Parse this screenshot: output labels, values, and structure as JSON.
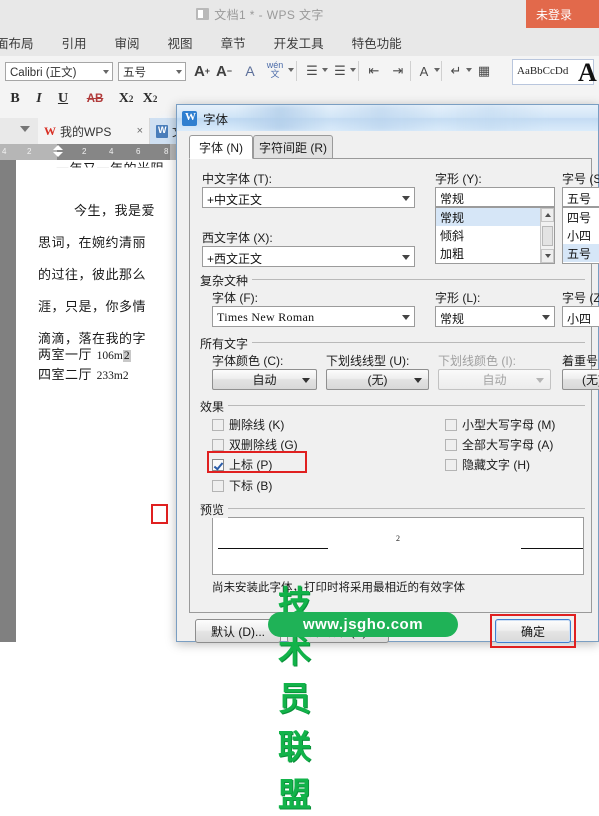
{
  "app": {
    "title": "文档1 * - WPS 文字",
    "login_button": "未登录"
  },
  "ribbon_tabs": [
    "面布局",
    "引用",
    "审阅",
    "视图",
    "章节",
    "开发工具",
    "特色功能"
  ],
  "font_toolbar": {
    "font_name": "Calibri (正文)",
    "font_size": "五号",
    "grow_font": "A",
    "shrink_font": "A",
    "clear_format": "A",
    "pinyin_top": "wén",
    "pinyin_bottom": "文",
    "bold": "B",
    "italic": "I",
    "underline": "U",
    "strikethrough": "AB",
    "superscript": "X",
    "superscript_sup": "2",
    "subscript": "X",
    "subscript_sub": "2",
    "style_preview": "AaBbCcDd",
    "style_big": "A"
  },
  "doc_tabs": [
    {
      "label": "我的WPS",
      "close": "×"
    },
    {
      "label": "文"
    }
  ],
  "ruler": {
    "marks": [
      "4",
      "2",
      "2",
      "4",
      "6",
      "8"
    ]
  },
  "document": {
    "lines": [
      "一年又一年的光阴",
      "今生，我是爱",
      "思词，在婉约清丽",
      "的过往，彼此那么",
      "涯，只是，你多情",
      "滴滴，落在我的字"
    ],
    "measure_lines": [
      {
        "cn": "两室一厅",
        "value": "106m",
        "sup": "2"
      },
      {
        "cn": "四室二厅",
        "value": "233m",
        "sup": "2"
      }
    ]
  },
  "dialog": {
    "title": "字体",
    "tabs": [
      {
        "label": "字体 (N)",
        "active": true
      },
      {
        "label": "字符间距 (R)",
        "active": false
      }
    ],
    "chinese_font": {
      "label": "中文字体 (T):",
      "value": "+中文正文"
    },
    "western_font": {
      "label": "西文字体 (X):",
      "value": "+西文正文"
    },
    "style": {
      "label": "字形 (Y):",
      "value": "常规",
      "options": [
        "常规",
        "倾斜",
        "加粗"
      ],
      "selected": "常规"
    },
    "size": {
      "label": "字号 (S):",
      "value": "五号",
      "options": [
        "四号",
        "小四",
        "五号"
      ],
      "selected": "五号"
    },
    "complex_group": {
      "title": "复杂文种",
      "font": {
        "label": "字体 (F):",
        "value": "Times New Roman"
      },
      "style": {
        "label": "字形 (L):",
        "value": "常规"
      },
      "size": {
        "label": "字号 (Z):",
        "value": "小四"
      }
    },
    "all_text_group": {
      "title": "所有文字",
      "font_color": {
        "label": "字体颜色 (C):",
        "value": "自动"
      },
      "underline_style": {
        "label": "下划线线型 (U):",
        "value": "(无)"
      },
      "underline_color": {
        "label": "下划线颜色 (I):",
        "value": "自动",
        "disabled": true
      },
      "emphasis": {
        "label": "着重号:",
        "value": "(无)"
      }
    },
    "effects_group": {
      "title": "效果",
      "left": [
        {
          "label": "删除线 (K)",
          "checked": false
        },
        {
          "label": "双删除线 (G)",
          "checked": false
        },
        {
          "label": "上标 (P)",
          "checked": true,
          "highlighted": true
        },
        {
          "label": "下标 (B)",
          "checked": false
        }
      ],
      "right": [
        {
          "label": "小型大写字母 (M)",
          "checked": false
        },
        {
          "label": "全部大写字母 (A)",
          "checked": false
        },
        {
          "label": "隐藏文字 (H)",
          "checked": false
        }
      ]
    },
    "preview": {
      "title": "预览",
      "sample": "2",
      "note": "尚未安装此字体，打印时将采用最相近的有效字体"
    },
    "buttons": {
      "default": "默认 (D)...",
      "text_effects": "文本效果 (E)...",
      "ok": "确定"
    }
  },
  "watermark": {
    "brand": "技术员联盟",
    "url": "www.jsgho.com"
  },
  "colors": {
    "accent_orange": "#e2694b",
    "highlight_red": "#e02020",
    "selection_blue": "#d6e6f7",
    "watermark_green": "#1fb257"
  }
}
